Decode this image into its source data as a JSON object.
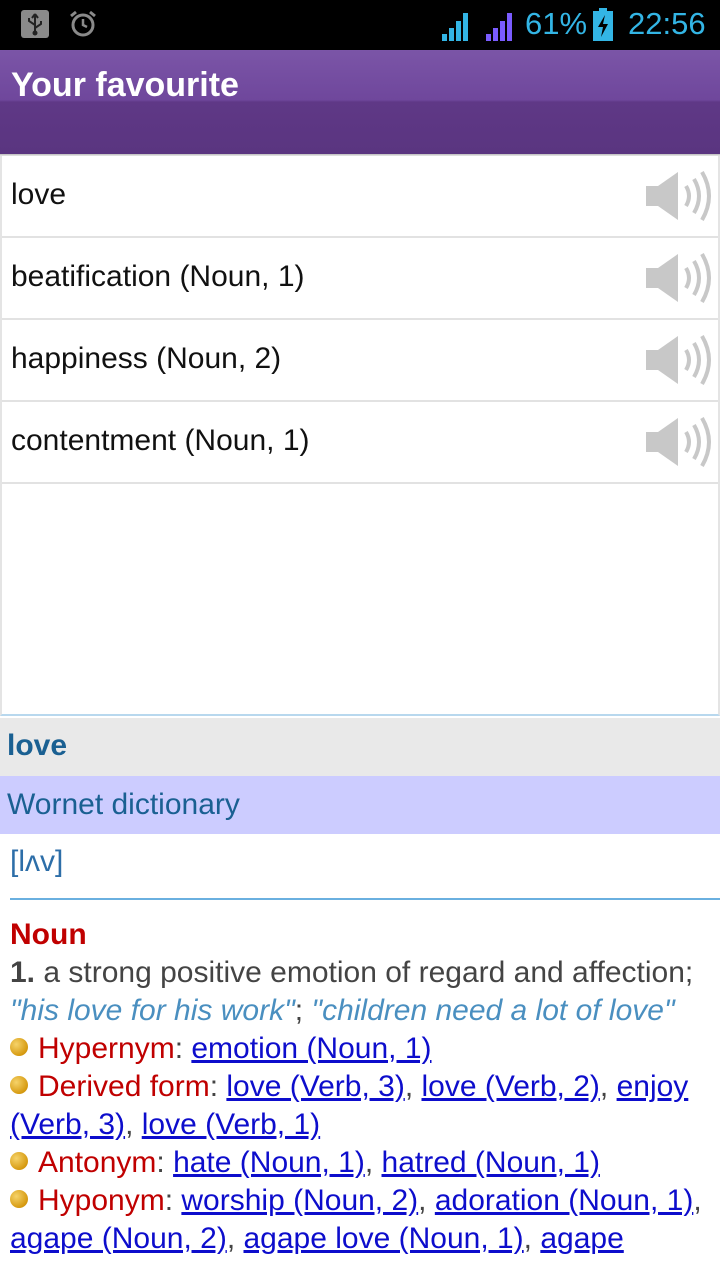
{
  "status_bar": {
    "battery_percent": "61%",
    "time": "22:56",
    "icons": [
      "usb-icon",
      "alarm-icon",
      "signal-icon",
      "signal-icon",
      "battery-charging-icon"
    ]
  },
  "action_bar": {
    "title": "Your favourite"
  },
  "favourites": [
    {
      "label": "love"
    },
    {
      "label": "beatification (Noun, 1)"
    },
    {
      "label": "happiness (Noun, 2)"
    },
    {
      "label": "contentment (Noun, 1)"
    }
  ],
  "definition": {
    "word": "love",
    "dictionary": "Wornet dictionary",
    "phonetic": "[lʌv]",
    "part_of_speech": "Noun",
    "sense_number": "1.",
    "gloss": "a strong positive emotion of regard and affection;",
    "example1": "\"his love for his work\"",
    "separator": ";",
    "example2": "\"children need a lot of love\"",
    "relations": {
      "hypernym": {
        "label": "Hypernym",
        "links": [
          "emotion (Noun, 1)"
        ]
      },
      "derived": {
        "label": "Derived form",
        "links": [
          "love (Verb, 3)",
          "love (Verb, 2)",
          "enjoy (Verb, 3)",
          "love (Verb, 1)"
        ]
      },
      "antonym": {
        "label": "Antonym",
        "links": [
          "hate (Noun, 1)",
          "hatred (Noun, 1)"
        ]
      },
      "hyponym": {
        "label": "Hyponym",
        "links": [
          "worship (Noun, 2)",
          "adoration (Noun, 1)",
          "agape (Noun, 2)",
          "agape love (Noun, 1)",
          "agape"
        ]
      }
    }
  },
  "colors": {
    "action_bar": "#6f479c",
    "status_text": "#33b5e5",
    "word_heading": "#1a6092",
    "dictionary_band": "#ccccff",
    "relation_label": "#c00000",
    "link": "#0d0dcc",
    "example": "#4a8fc0"
  }
}
